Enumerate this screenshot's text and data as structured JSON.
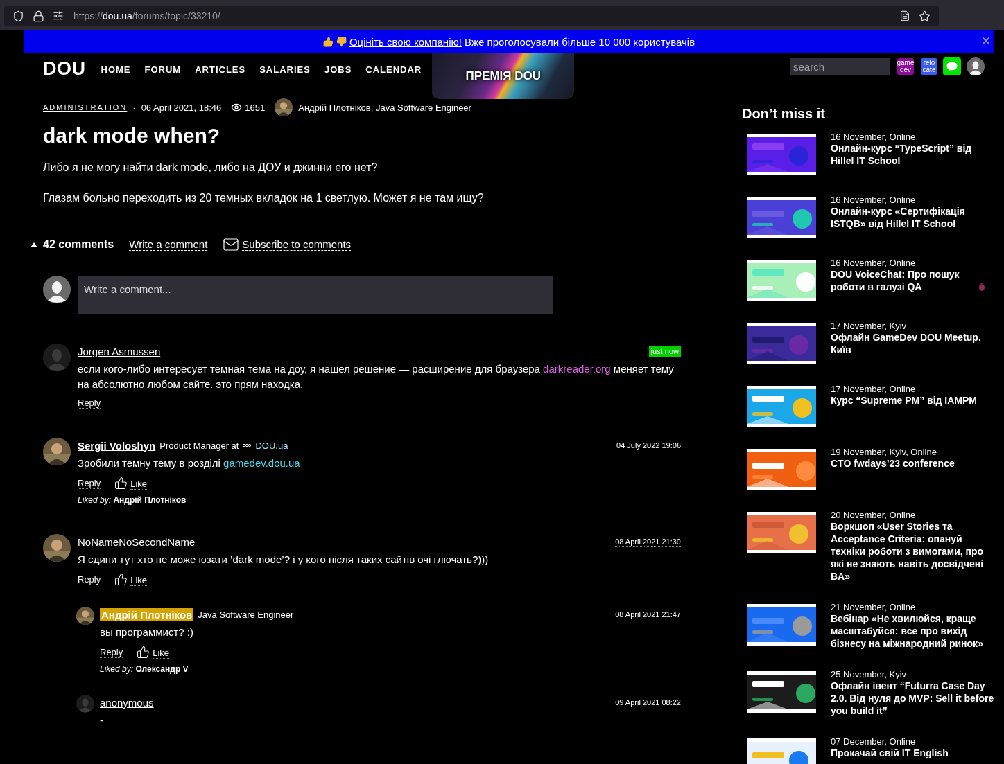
{
  "browser": {
    "url_scheme": "https://",
    "url_host": "dou.ua",
    "url_path": "/forums/topic/33210/"
  },
  "banner": {
    "link": "Оцініть свою компанію!",
    "text": "Вже проголосували більше 10 000 користувачів"
  },
  "header": {
    "logo": "DOU",
    "nav": [
      {
        "label": "HOME"
      },
      {
        "label": "FORUM"
      },
      {
        "label": "ARTICLES"
      },
      {
        "label": "SALARIES"
      },
      {
        "label": "JOBS"
      },
      {
        "label": "CALENDAR"
      }
    ],
    "award": "ПРЕМІЯ DOU",
    "search": {
      "placeholder": "search"
    },
    "apps": [
      {
        "lines": [
          "game",
          "dev"
        ],
        "color": "#8c0c9c"
      },
      {
        "lines": [
          "relo",
          "cate"
        ],
        "color": "#3b5cf2"
      }
    ]
  },
  "topic": {
    "category": "ADMINISTRATION",
    "separator": "·",
    "date": "06 April 2021, 18:46",
    "views": "1651",
    "author": "Андрій Плотніков",
    "author_position": ", Java Software Engineer",
    "title": "dark mode when?",
    "paragraphs": [
      "Либо я не могу найти dark mode, либо на ДОУ и джинни его нет?",
      "Глазам больно переходить из 20 темных вкладок на 1 светлую. Может я не там ищу?"
    ]
  },
  "comments_bar": {
    "count": "42 comments",
    "expanded": true,
    "write": "Write a comment",
    "subscribe": "Subscribe to comments"
  },
  "compose": {
    "placeholder": "Write a comment..."
  },
  "comments": [
    {
      "avatar": {
        "kind": "silhouette"
      },
      "author": "Jorgen Asmussen",
      "highlighted": false,
      "date": "just now",
      "new": true,
      "body": [
        {
          "kind": "text",
          "text": "если кого-либо интересует темная тема на доу, я нашел решение — расширение для браузера "
        },
        {
          "kind": "link",
          "text": "darkreader.org",
          "color": "#e060e8"
        },
        {
          "kind": "text",
          "text": " меняет тему на абсолютно любом сайте. это прям находка."
        }
      ],
      "reply": "Reply"
    },
    {
      "avatar": {
        "kind": "picture"
      },
      "author": "Sergii Voloshyn",
      "highlighted": false,
      "position": "Product Manager at",
      "company": "DOU.ua",
      "date": "04 July 2022 19:06",
      "new": false,
      "body": [
        {
          "kind": "text",
          "text": "Зробили темну тему в розділі "
        },
        {
          "kind": "link",
          "text": "gamedev.dou.ua",
          "color": "#4fd6e8"
        }
      ],
      "reply": "Reply",
      "like": "Like",
      "liked_by": "*Liked by:* **Андрій Плотніков**"
    },
    {
      "avatar": {
        "kind": "picture"
      },
      "author": "NoNameNoSecondName",
      "highlighted": false,
      "date": "08 April 2021 21:39",
      "new": false,
      "body": [
        {
          "kind": "text",
          "text": "Я єдини тут хто не може юзати ’dark mode’? і у кого після таких сайтів очі глючать?)))"
        }
      ],
      "reply": "Reply",
      "like": "Like",
      "children": [
        {
          "avatar": {
            "kind": "picture"
          },
          "author": "Андрій Плотніков",
          "highlighted": true,
          "position": "Java Software Engineer",
          "date": "08 April 2021 21:47",
          "new": false,
          "body": [
            {
              "kind": "text",
              "text": "вы программист? :)"
            }
          ],
          "reply": "Reply",
          "like": "Like",
          "liked_by": "*Liked by:* **Олександр V**"
        },
        {
          "avatar": {
            "kind": "silhouette"
          },
          "author": "anonymous",
          "highlighted": false,
          "date": "09 April 2021 08:22",
          "new": false,
          "body": [
            {
              "kind": "text",
              "text": "-"
            }
          ]
        }
      ]
    }
  ],
  "sidebar": {
    "title": "Don’t miss it",
    "events": [
      {
        "date": "16 November, Online",
        "title": "Онлайн-курс “TypeScript” від Hillel IT School",
        "kind": "plain"
      },
      {
        "date": "16 November, Online",
        "title": "Онлайн-курс «Сертифікація ISTQB» від Hillel IT School",
        "kind": "plain"
      },
      {
        "date": "16 November, Online",
        "title": "DOU VoiceChat: Про пошук роботи в галузі QA",
        "kind": "with_icon"
      },
      {
        "date": "17 November, Kyiv",
        "title": "Офлайн GameDev DOU Meetup. Київ",
        "kind": "plain"
      },
      {
        "date": "17 November, Online",
        "title": "Курс “Supreme PM” від IAMPM",
        "kind": "plain"
      },
      {
        "date": "19 November, Kyiv, Online",
        "title": "CTO fwdays’23 conference",
        "kind": "plain"
      },
      {
        "date": "20 November, Online",
        "title": "Воркшоп «User Stories та Acceptance Criteria: опануй техніки роботи з вимогами, про які не знають навіть досвідчені BA»",
        "kind": "plain"
      },
      {
        "date": "21 November, Online",
        "title": "Вебінар «Не хвилюйся, краще масштабуйся: все про вихід бізнесу на міжнародний ринок»",
        "kind": "plain"
      },
      {
        "date": "25 November, Kyiv",
        "title": "Офлайн івент “Futurra Case Day 2.0. Від нуля до MVP: Sell it before you build it”",
        "kind": "plain"
      },
      {
        "date": "07 December, Online",
        "title": "Прокачай свій IT English",
        "kind": "plain"
      }
    ]
  }
}
